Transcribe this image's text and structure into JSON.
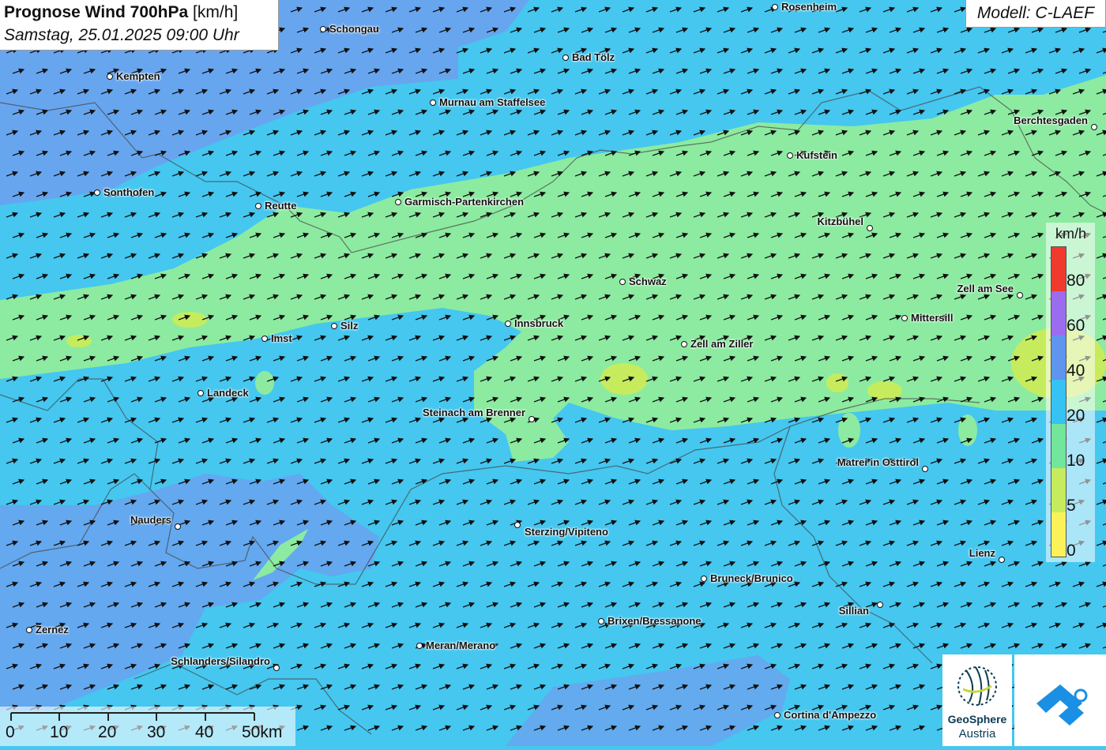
{
  "title": {
    "main": "Prognose Wind 700hPa",
    "unit": "[km/h]",
    "datetime": "Samstag, 25.01.2025 09:00 Uhr"
  },
  "model": "Modell: C-LAEF",
  "legend": {
    "unit": "km/h",
    "classes": [
      {
        "label": "80",
        "color": "#f03a2e"
      },
      {
        "label": "60",
        "color": "#9b6cf0"
      },
      {
        "label": "40",
        "color": "#5f94ef"
      },
      {
        "label": "20",
        "color": "#36c2f2"
      },
      {
        "label": "10",
        "color": "#72e69a"
      },
      {
        "label": "5",
        "color": "#c6ec5d"
      },
      {
        "label": "0",
        "color": "#fbf25a"
      }
    ]
  },
  "scale": {
    "ticks": [
      "0",
      "10",
      "20",
      "30",
      "40",
      "50km"
    ]
  },
  "cities": [
    {
      "name": "Rosenheim"
    },
    {
      "name": "Schongau"
    },
    {
      "name": "Bad Tölz"
    },
    {
      "name": "Kempten"
    },
    {
      "name": "Murnau am Staffelsee"
    },
    {
      "name": "Berchtesgaden"
    },
    {
      "name": "Kufstein"
    },
    {
      "name": "Sonthofen"
    },
    {
      "name": "Reutte"
    },
    {
      "name": "Garmisch-Partenkirchen"
    },
    {
      "name": "Kitzbühel"
    },
    {
      "name": "Schwaz"
    },
    {
      "name": "Zell am See"
    },
    {
      "name": "Innsbruck"
    },
    {
      "name": "Mittersill"
    },
    {
      "name": "Silz"
    },
    {
      "name": "Imst"
    },
    {
      "name": "Zell am Ziller"
    },
    {
      "name": "Landeck"
    },
    {
      "name": "Steinach am Brenner"
    },
    {
      "name": "Matrei in Osttirol"
    },
    {
      "name": "Nauders"
    },
    {
      "name": "Sterzing/Vipiteno"
    },
    {
      "name": "Lienz"
    },
    {
      "name": "Bruneck/Brunico"
    },
    {
      "name": "Sillian"
    },
    {
      "name": "Brixen/Bressanone"
    },
    {
      "name": "Zernez"
    },
    {
      "name": "Meran/Merano"
    },
    {
      "name": "Schlanders/Silandro"
    },
    {
      "name": "Cortina d'Ampezzo"
    }
  ],
  "wind_direction": "WSW→ENE",
  "logos": {
    "geosphere_name": "GeoSphere",
    "geosphere_sub": "Austria"
  }
}
